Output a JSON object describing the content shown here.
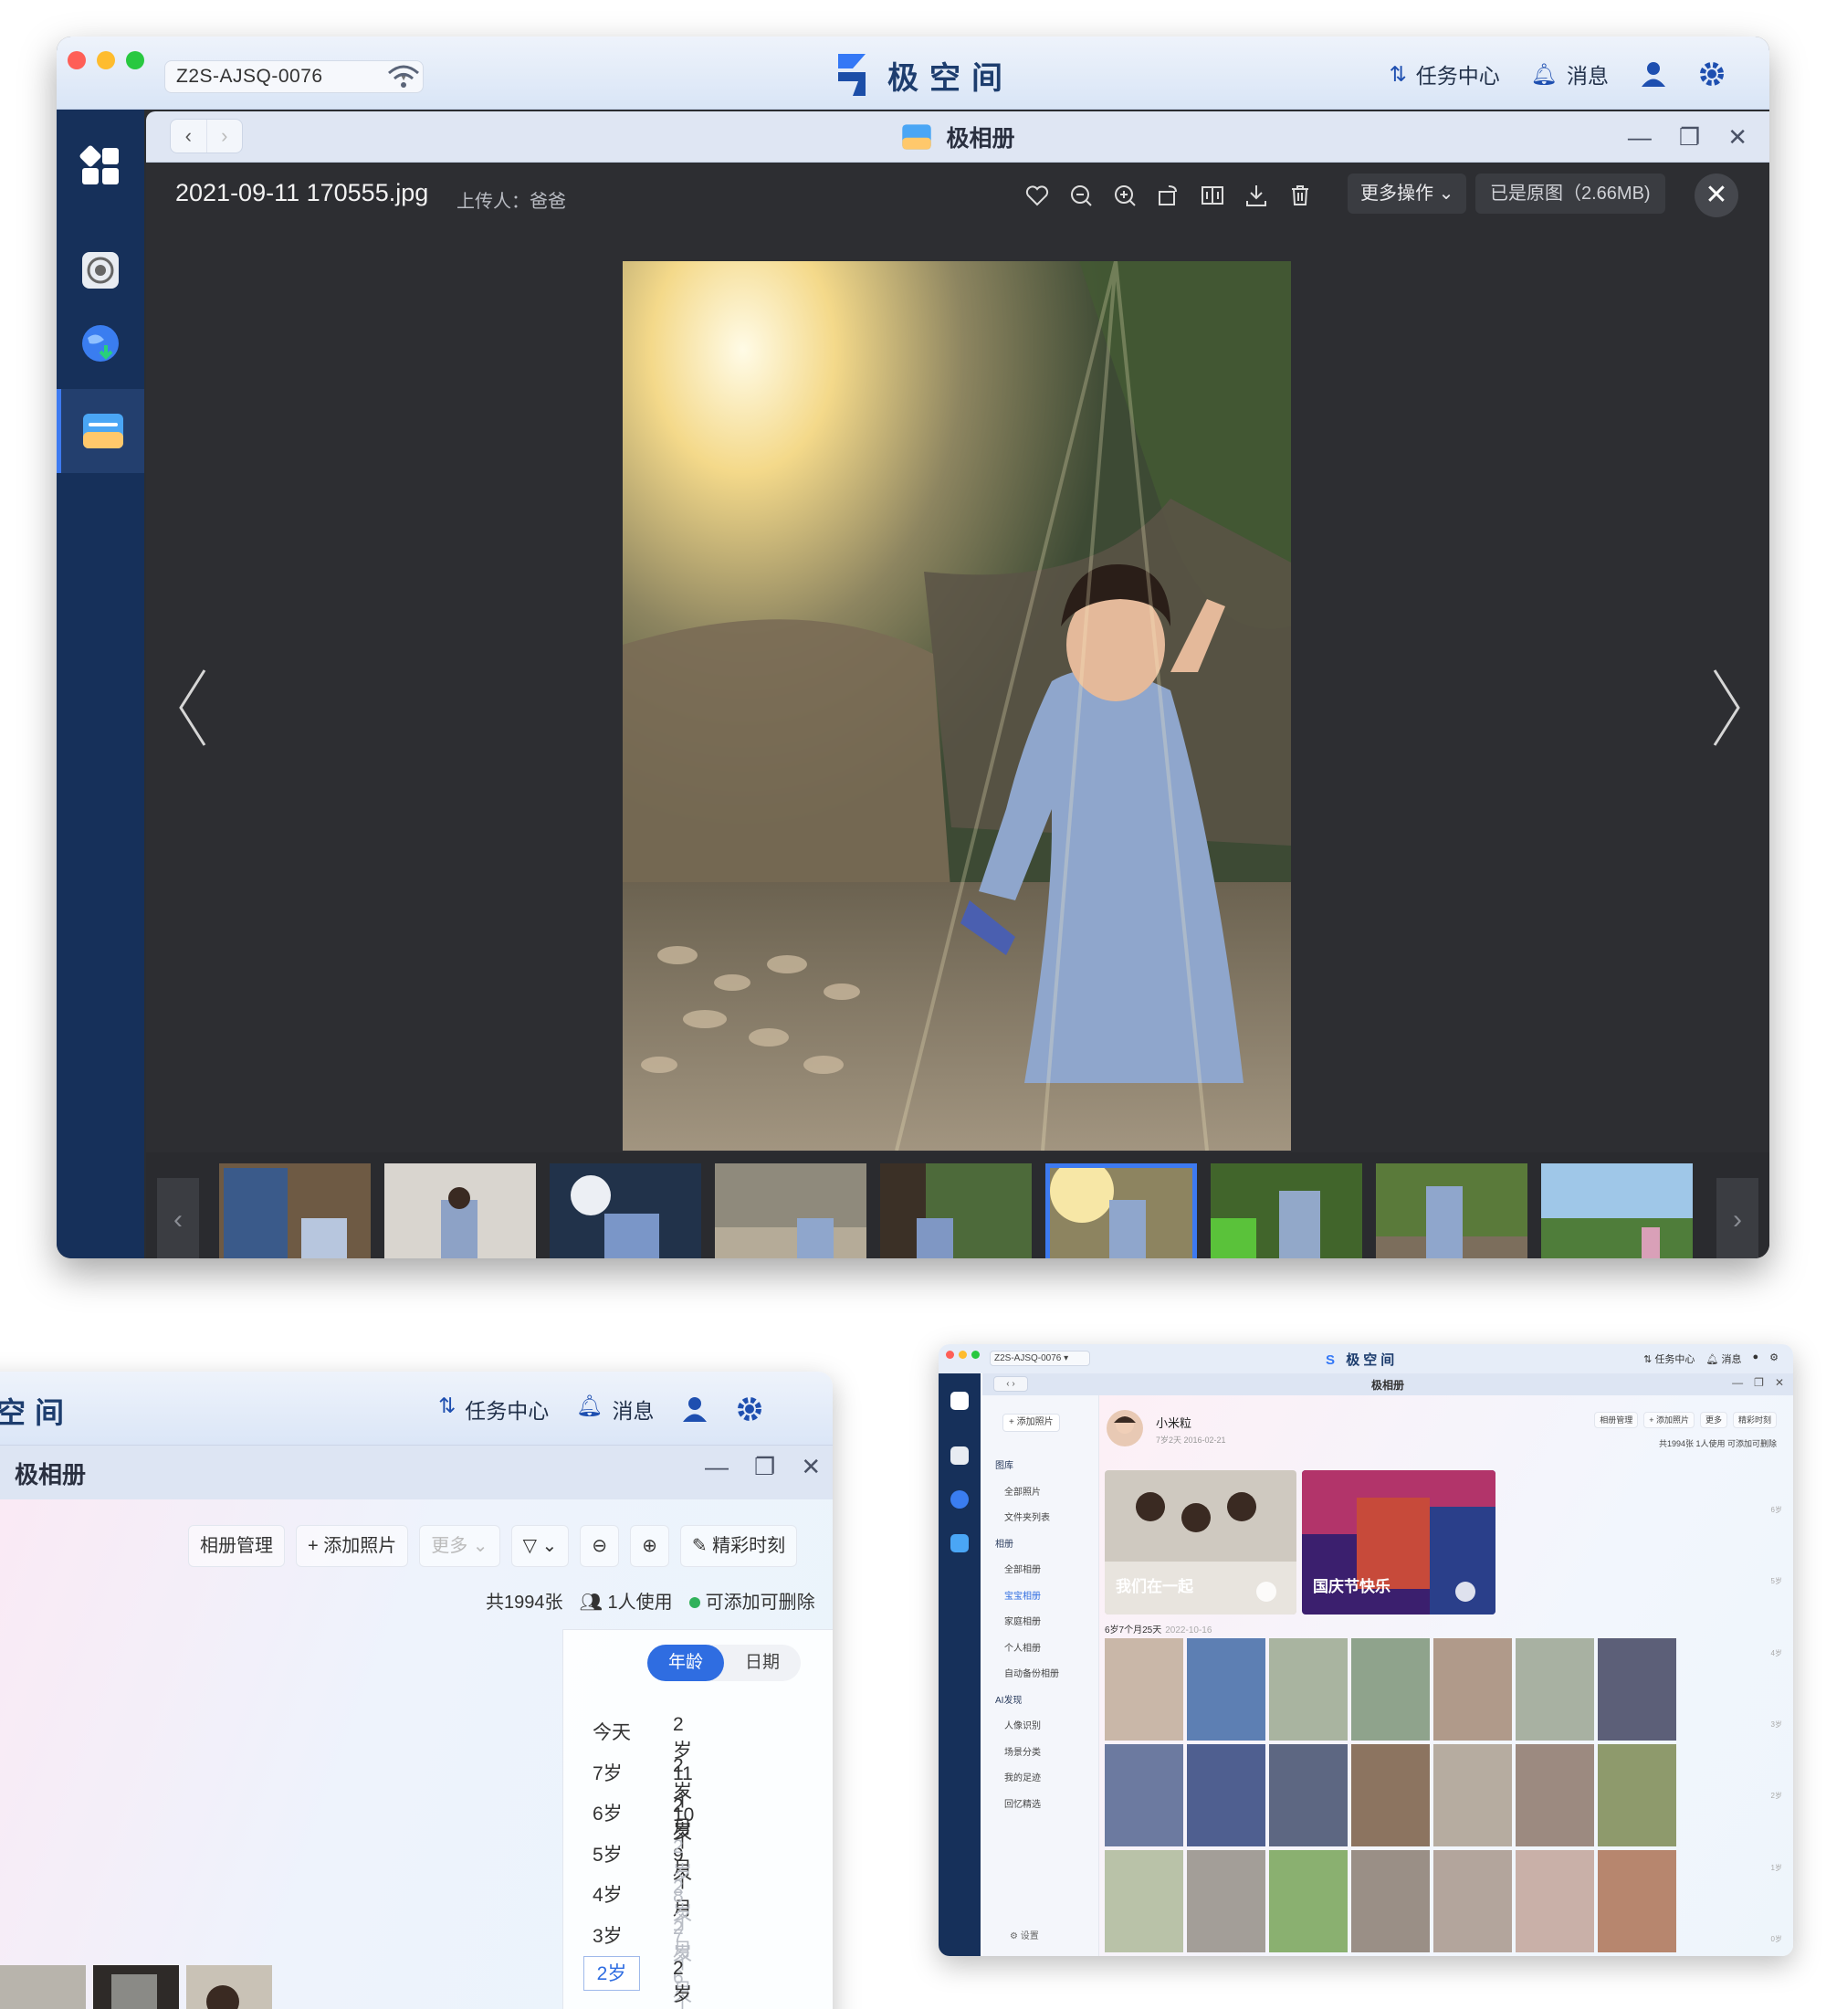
{
  "main_window": {
    "device": "Z2S-AJSQ-0076",
    "brand": "极空间",
    "top_actions": {
      "tasks": "任务中心",
      "messages": "消息"
    },
    "inner_title": "极相册",
    "viewer": {
      "filename": "2021-09-11 170555.jpg",
      "uploader": "上传人：爸爸",
      "more_actions": "更多操作",
      "original_label": "已是原图（2.66MB)"
    }
  },
  "bottom_left": {
    "brand": "空间",
    "top_actions": {
      "tasks": "任务中心",
      "messages": "消息"
    },
    "title": "极相册",
    "toolbar": {
      "album_manage": "相册管理",
      "add_photos": "添加照片",
      "more": "更多",
      "highlights": "精彩时刻"
    },
    "stats": {
      "total": "共1994张",
      "users": "1人使用",
      "status": "可添加可删除"
    },
    "segment": {
      "age": "年龄",
      "date": "日期"
    },
    "ages": [
      {
        "age": "今天",
        "month": "2岁11个月"
      },
      {
        "age": "7岁",
        "month": "2岁10个月"
      },
      {
        "age": "6岁",
        "month": "2岁9个月"
      },
      {
        "age": "5岁",
        "month": "2岁8个月"
      },
      {
        "age": "4岁",
        "month": "2岁7个月"
      },
      {
        "age": "3岁",
        "month": "2岁6个月"
      },
      {
        "age": "2岁",
        "month": "2岁5个月"
      }
    ]
  },
  "bottom_right": {
    "device": "Z2S-AJSQ-0076",
    "brand": "极空间",
    "top_actions": {
      "tasks": "任务中心",
      "messages": "消息"
    },
    "title": "极相册",
    "add_photos": "+ 添加照片",
    "nav": [
      {
        "label": "图库",
        "header": true
      },
      {
        "label": "全部照片"
      },
      {
        "label": "文件夹列表"
      },
      {
        "label": "相册",
        "header": true
      },
      {
        "label": "全部相册"
      },
      {
        "label": "宝宝相册",
        "active": true
      },
      {
        "label": "家庭相册"
      },
      {
        "label": "个人相册"
      },
      {
        "label": "自动备份相册"
      },
      {
        "label": "AI发现",
        "header": true
      },
      {
        "label": "人像识别"
      },
      {
        "label": "场景分类"
      },
      {
        "label": "我的足迹"
      },
      {
        "label": "回忆精选"
      }
    ],
    "settings": "设置",
    "profile": {
      "name": "小米粒",
      "sub": "7岁2天 2016-02-21"
    },
    "tools": [
      "相册管理",
      "+ 添加照片",
      "更多",
      "精彩时刻"
    ],
    "stats": "共1994张  1人使用  可添加可删除",
    "cards": [
      "我们在一起",
      "国庆节快乐"
    ],
    "group_date": "6岁7个月25天",
    "group_date_sub": "2022-10-16",
    "scale": [
      "6岁",
      "5岁",
      "4岁",
      "3岁",
      "2岁",
      "1岁",
      "0岁"
    ]
  },
  "colors": {
    "accent": "#3d7af0",
    "brand_dark": "#1d3d6e",
    "sidebar": "#16305a"
  }
}
